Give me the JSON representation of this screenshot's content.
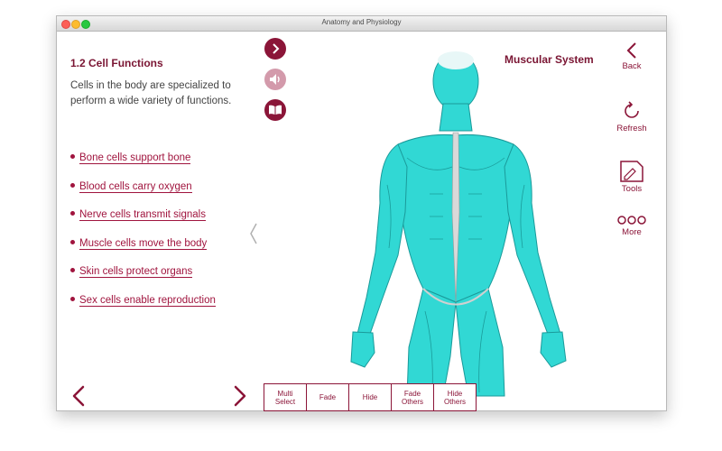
{
  "window": {
    "title": "Anatomy and Physiology"
  },
  "lesson": {
    "title": "1.2 Cell Functions",
    "intro": "Cells in the body are specialized to perform a wide variety of functions.",
    "facts": [
      "Bone cells support bone",
      "Blood cells carry oxygen",
      "Nerve cells transmit signals",
      "Muscle cells move the body",
      "Skin cells protect organs",
      "Sex cells enable reproduction"
    ]
  },
  "viewer": {
    "system_title": "Muscular System",
    "model_description": "3D muscular system model, turquoise figure"
  },
  "sidebar": {
    "back_label": "Back",
    "refresh_label": "Refresh",
    "tools_label": "Tools",
    "more_label": "More"
  },
  "toolbar": {
    "buttons": [
      "Multi\nSelect",
      "Fade",
      "Hide",
      "Fade\nOthers",
      "Hide\nOthers"
    ]
  },
  "colors": {
    "accent": "#8b1538",
    "model": "#31d8d4",
    "titlebar": "#e0e0e0"
  },
  "icons": [
    "play-icon",
    "speaker-icon",
    "book-icon",
    "back-icon",
    "refresh-icon",
    "tools-icon",
    "more-icon",
    "prev-arrow-icon",
    "next-arrow-icon",
    "collapse-icon"
  ]
}
